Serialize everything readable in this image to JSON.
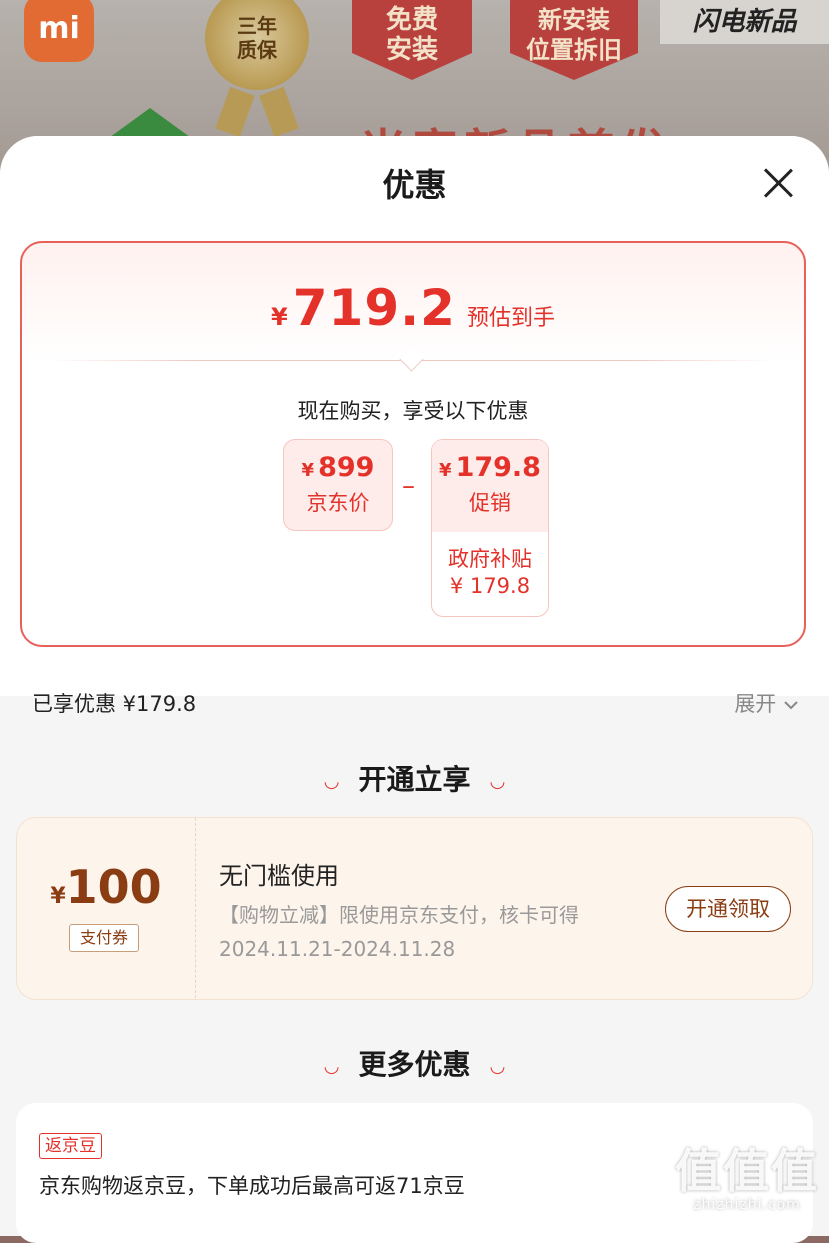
{
  "banner": {
    "logo_text": "mi",
    "medal_line1": "三年",
    "medal_line2": "质保",
    "badge1_line1": "免费",
    "badge1_line2": "安装",
    "badge2_line1": "新安装",
    "badge2_line2": "位置拆旧",
    "flash_text": "闪电新品",
    "headline_partial": "米家新品首发"
  },
  "sheet": {
    "title": "优惠",
    "close_icon": "close-icon"
  },
  "estimate": {
    "currency": "¥",
    "amount": "719.2",
    "label": "预估到手"
  },
  "breakdown": {
    "intro": "现在购买，享受以下优惠",
    "jd_price_value": "899",
    "jd_price_currency": "¥",
    "jd_price_label": "京东价",
    "operator": "–",
    "promo_value": "179.8",
    "promo_currency": "¥",
    "promo_label": "促销",
    "subsidy_label": "政府补贴",
    "subsidy_value": "¥ 179.8"
  },
  "summary": {
    "enjoyed": "已享优惠 ¥179.8",
    "expand": "展开"
  },
  "section_open": {
    "title": "开通立享"
  },
  "coupon": {
    "currency": "¥",
    "amount": "100",
    "tag": "支付券",
    "title": "无门槛使用",
    "desc": "【购物立减】限使用京东支付，核卡可得",
    "date": "2024.11.21-2024.11.28",
    "button": "开通领取"
  },
  "section_more": {
    "title": "更多优惠"
  },
  "bean": {
    "tag": "返京豆",
    "text": "京东购物返京豆，下单成功后最高可返71京豆"
  },
  "watermark": {
    "logo": "值值值",
    "url": "zhizhizhi.com"
  }
}
